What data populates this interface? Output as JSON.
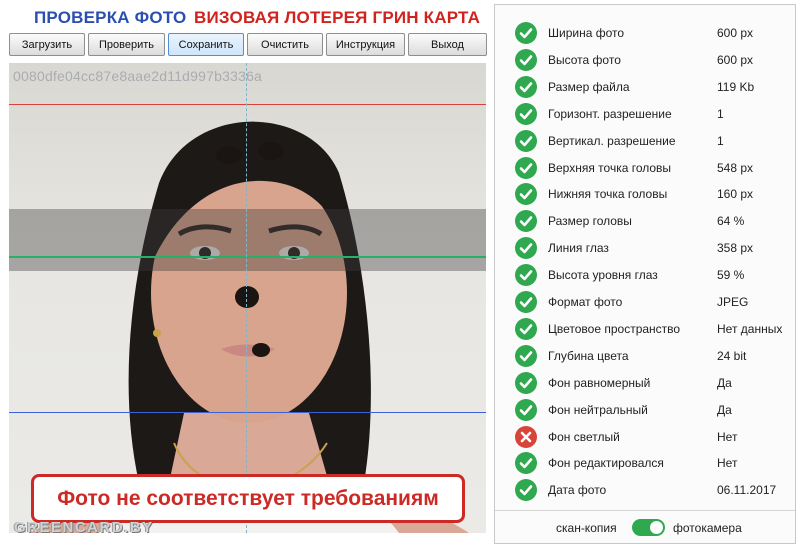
{
  "header": {
    "title_blue": "ПРОВЕРКА ФОТО",
    "title_red": "ВИЗОВАЯ ЛОТЕРЕЯ ГРИН КАРТА"
  },
  "toolbar": {
    "buttons": [
      {
        "label": "Загрузить",
        "active": false
      },
      {
        "label": "Проверить",
        "active": false
      },
      {
        "label": "Сохранить",
        "active": true
      },
      {
        "label": "Очистить",
        "active": false
      },
      {
        "label": "Инструкция",
        "active": false
      },
      {
        "label": "Выход",
        "active": false
      }
    ]
  },
  "photo": {
    "hash": "0080dfe04cc87e8aae2d11d997b3336a",
    "guide_colors": {
      "top": "#d9413d",
      "eyes": "#27b06a",
      "chin": "#3b63d6",
      "center": "#7fb6c9"
    },
    "warning": "Фото не соответствует требованиям",
    "watermark": "GREENCARD.BY"
  },
  "checks": [
    {
      "label": "Ширина фото",
      "value": "600 px",
      "status": "ok"
    },
    {
      "label": "Высота фото",
      "value": "600 px",
      "status": "ok"
    },
    {
      "label": "Размер файла",
      "value": "119 Kb",
      "status": "ok"
    },
    {
      "label": "Горизонт. разрешение",
      "value": "1",
      "status": "ok"
    },
    {
      "label": "Вертикал. разрешение",
      "value": "1",
      "status": "ok"
    },
    {
      "label": "Верхняя точка головы",
      "value": "548 px",
      "status": "ok"
    },
    {
      "label": "Нижняя точка головы",
      "value": "160 px",
      "status": "ok"
    },
    {
      "label": "Размер головы",
      "value": "64 %",
      "status": "ok"
    },
    {
      "label": "Линия глаз",
      "value": "358 px",
      "status": "ok"
    },
    {
      "label": "Высота уровня глаз",
      "value": "59 %",
      "status": "ok"
    },
    {
      "label": "Формат фото",
      "value": "JPEG",
      "status": "ok"
    },
    {
      "label": "Цветовое пространство",
      "value": "Нет данных",
      "status": "ok"
    },
    {
      "label": "Глубина цвета",
      "value": "24 bit",
      "status": "ok"
    },
    {
      "label": "Фон равномерный",
      "value": "Да",
      "status": "ok"
    },
    {
      "label": "Фон нейтральный",
      "value": "Да",
      "status": "ok"
    },
    {
      "label": "Фон светлый",
      "value": "Нет",
      "status": "bad"
    },
    {
      "label": "Фон редактировался",
      "value": "Нет",
      "status": "ok"
    },
    {
      "label": "Дата фото",
      "value": "06.11.2017",
      "status": "ok"
    }
  ],
  "mode_toggle": {
    "left_label": "скан-копия",
    "right_label": "фотокамера",
    "selected": "фотокамера"
  },
  "colors": {
    "ok": "#2fa84f",
    "bad": "#d9443a",
    "warning": "#cc2a24"
  }
}
